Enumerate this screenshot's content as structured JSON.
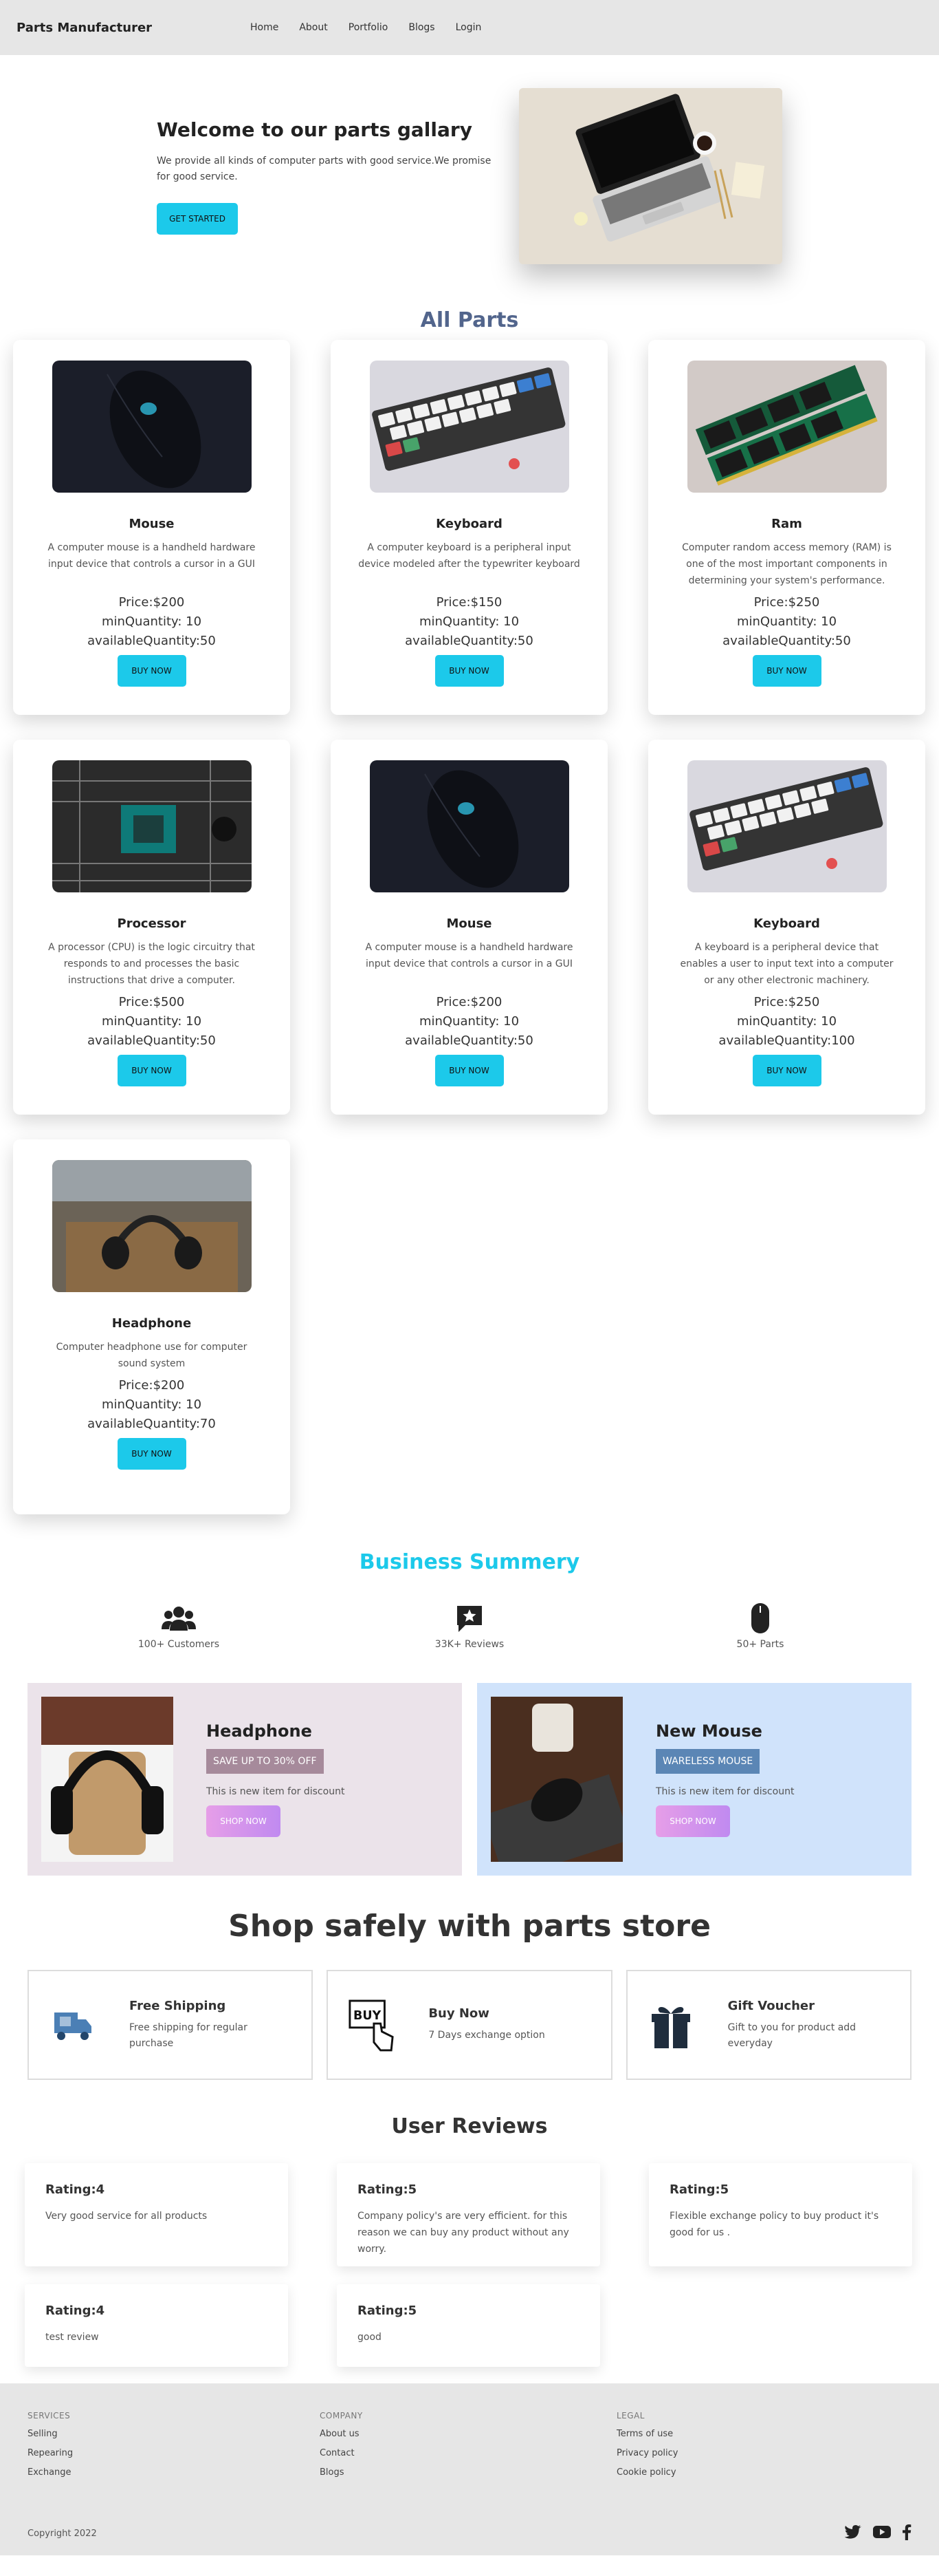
{
  "navbar": {
    "brand": "Parts Manufacturer",
    "links": [
      "Home",
      "About",
      "Portfolio",
      "Blogs",
      "Login"
    ]
  },
  "hero": {
    "title": "Welcome to our parts gallary",
    "text": "We provide all kinds of computer parts with good service.We promise for good service.",
    "button": "GET STARTED"
  },
  "parts": {
    "title": "All Parts",
    "buy_label": "BUY NOW",
    "items": [
      {
        "name": "Mouse",
        "desc": "A computer mouse is a handheld hardware input device that controls a cursor in a GUI",
        "price": "Price:$200",
        "min": "minQuantity: 10",
        "avail": "availableQuantity:50"
      },
      {
        "name": "Keyboard",
        "desc": "A computer keyboard is a peripheral input device modeled after the typewriter keyboard",
        "price": "Price:$150",
        "min": "minQuantity: 10",
        "avail": "availableQuantity:50"
      },
      {
        "name": "Ram",
        "desc": "Computer random access memory (RAM) is one of the most important components in determining your system's performance.",
        "price": "Price:$250",
        "min": "minQuantity: 10",
        "avail": "availableQuantity:50"
      },
      {
        "name": "Processor",
        "desc": "A processor (CPU) is the logic circuitry that responds to and processes the basic instructions that drive a computer.",
        "price": "Price:$500",
        "min": "minQuantity: 10",
        "avail": "availableQuantity:50"
      },
      {
        "name": "Mouse",
        "desc": "A computer mouse is a handheld hardware input device that controls a cursor in a GUI",
        "price": "Price:$200",
        "min": "minQuantity: 10",
        "avail": "availableQuantity:50"
      },
      {
        "name": "Keyboard",
        "desc": "A keyboard is a peripheral device that enables a user to input text into a computer or any other electronic machinery.",
        "price": "Price:$250",
        "min": "minQuantity: 10",
        "avail": "availableQuantity:100"
      },
      {
        "name": "Headphone",
        "desc": "Computer headphone use for computer sound system",
        "price": "Price:$200",
        "min": "minQuantity: 10",
        "avail": "availableQuantity:70"
      }
    ]
  },
  "business": {
    "title": "Business Summery",
    "stats": [
      "100+ Customers",
      "33K+ Reviews",
      "50+ Parts"
    ]
  },
  "promos": [
    {
      "title": "Headphone",
      "badge": "SAVE UP TO 30% OFF",
      "text": "This is new item for discount",
      "button": "SHOP NOW"
    },
    {
      "title": "New Mouse",
      "badge": "WARELESS MOUSE",
      "text": "This is new item for discount",
      "button": "SHOP NOW"
    }
  ],
  "safe": {
    "title": "Shop safely with parts store",
    "features": [
      {
        "title": "Free Shipping",
        "text": "Free shipping for regular purchase"
      },
      {
        "title": "Buy Now",
        "text": "7 Days exchange option"
      },
      {
        "title": "Gift Voucher",
        "text": "Gift to you for product add everyday"
      }
    ]
  },
  "reviews": {
    "title": "User Reviews",
    "items": [
      {
        "rating": "Rating:4",
        "text": "Very good service for all products"
      },
      {
        "rating": "Rating:5",
        "text": "Company policy's are very efficient. for this reason we can buy any product without any worry."
      },
      {
        "rating": "Rating:5",
        "text": "Flexible exchange policy to buy product it's good for us ."
      },
      {
        "rating": "Rating:4",
        "text": "test review"
      },
      {
        "rating": "Rating:5",
        "text": "good"
      }
    ]
  },
  "footer": {
    "services": {
      "title": "SERVICES",
      "links": [
        "Selling",
        "Repearing",
        "Exchange"
      ]
    },
    "company": {
      "title": "COMPANY",
      "links": [
        "About us",
        "Contact",
        "Blogs"
      ]
    },
    "legal": {
      "title": "LEGAL",
      "links": [
        "Terms of use",
        "Privacy policy",
        "Cookie policy"
      ]
    },
    "copyright": "Copyright 2022",
    "socials": [
      "twitter-icon",
      "youtube-icon",
      "facebook-icon"
    ]
  }
}
